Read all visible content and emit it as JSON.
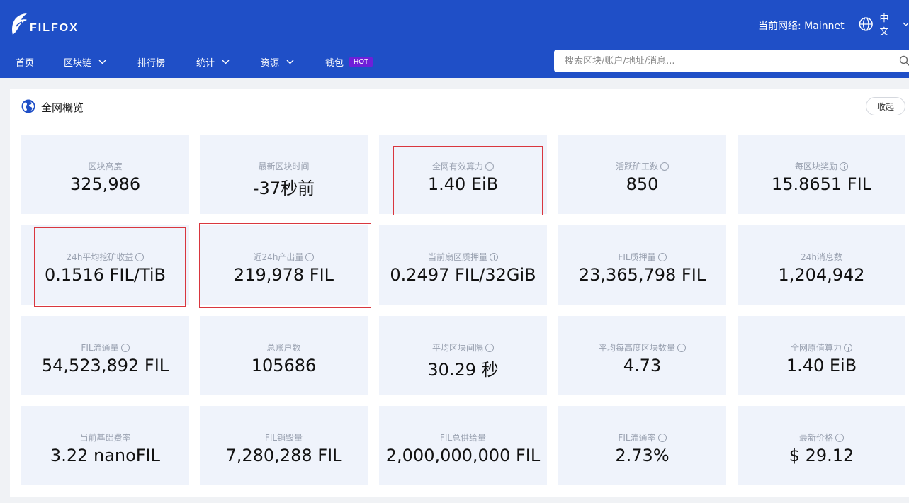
{
  "header": {
    "logo_text": "FILFOX",
    "network_label": "当前网络: Mainnet",
    "language": "中文"
  },
  "nav": {
    "items": [
      {
        "label": "首页",
        "dropdown": false
      },
      {
        "label": "区块链",
        "dropdown": true
      },
      {
        "label": "排行榜",
        "dropdown": false
      },
      {
        "label": "统计",
        "dropdown": true
      },
      {
        "label": "资源",
        "dropdown": true
      },
      {
        "label": "钱包",
        "dropdown": false,
        "badge": "HOT"
      }
    ]
  },
  "search": {
    "placeholder": "搜索区块/账户/地址/消息..."
  },
  "overview": {
    "title": "全网概览",
    "collapse_label": "收起",
    "stats": [
      {
        "label": "区块高度",
        "value": "325,986",
        "info": false
      },
      {
        "label": "最新区块时间",
        "value": "-37秒前",
        "info": false
      },
      {
        "label": "全网有效算力",
        "value": "1.40 EiB",
        "info": true
      },
      {
        "label": "活跃矿工数",
        "value": "850",
        "info": true
      },
      {
        "label": "每区块奖励",
        "value": "15.8651 FIL",
        "info": true
      },
      {
        "label": "24h平均挖矿收益",
        "value": "0.1516 FIL/TiB",
        "info": true
      },
      {
        "label": "近24h产出量",
        "value": "219,978 FIL",
        "info": true
      },
      {
        "label": "当前扇区质押量",
        "value": "0.2497 FIL/32GiB",
        "info": true
      },
      {
        "label": "FIL质押量",
        "value": "23,365,798 FIL",
        "info": true
      },
      {
        "label": "24h消息数",
        "value": "1,204,942",
        "info": false
      },
      {
        "label": "FIL流通量",
        "value": "54,523,892 FIL",
        "info": true
      },
      {
        "label": "总账户数",
        "value": "105686",
        "info": false
      },
      {
        "label": "平均区块间隔",
        "value": "30.29 秒",
        "info": true
      },
      {
        "label": "平均每高度区块数量",
        "value": "4.73",
        "info": true
      },
      {
        "label": "全网原值算力",
        "value": "1.40 EiB",
        "info": true
      },
      {
        "label": "当前基础费率",
        "value": "3.22 nanoFIL",
        "info": false
      },
      {
        "label": "FIL销毁量",
        "value": "7,280,288 FIL",
        "info": false
      },
      {
        "label": "FIL总供给量",
        "value": "2,000,000,000 FIL",
        "info": false
      },
      {
        "label": "FIL流通率",
        "value": "2.73%",
        "info": true
      },
      {
        "label": "最新价格",
        "value": "$ 29.12",
        "info": true
      }
    ]
  },
  "colors": {
    "header_bg": "#1f4fc7",
    "card_bg": "#eff3fb",
    "hot_badge": "#6f1fd8",
    "highlight_border": "#d9363e"
  }
}
